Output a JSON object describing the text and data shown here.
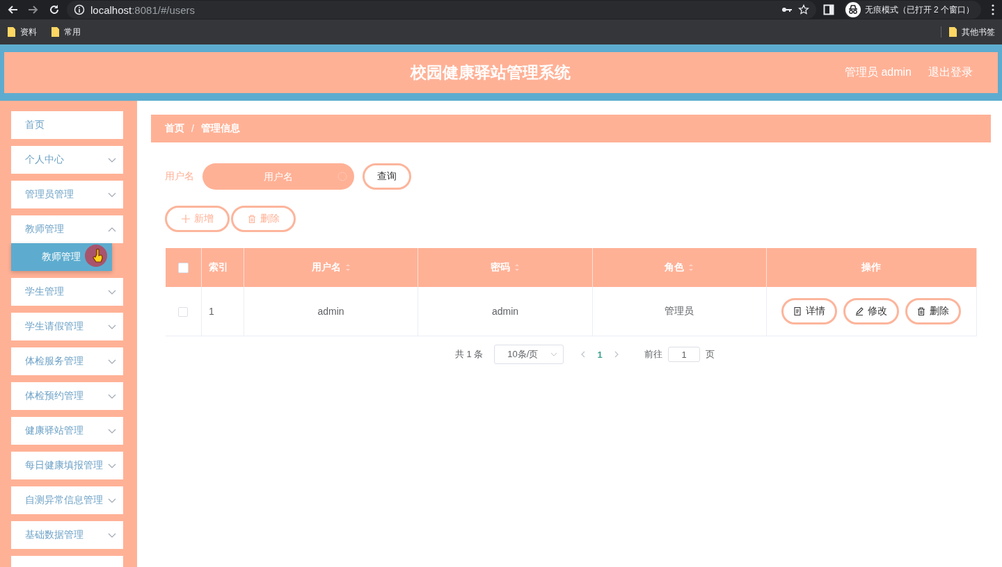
{
  "browser": {
    "url_host": "localhost",
    "url_rest": ":8081/#/users",
    "incognito": "无痕模式（已打开 2 个窗口）",
    "bookmarks": [
      "资料",
      "常用"
    ],
    "other_bookmarks": "其他书签"
  },
  "header": {
    "title": "校园健康驿站管理系统",
    "user": "管理员 admin",
    "logout": "退出登录"
  },
  "sidebar": {
    "items": [
      {
        "label": "首页",
        "expandable": false,
        "expanded": false
      },
      {
        "label": "个人中心",
        "expandable": true,
        "expanded": false
      },
      {
        "label": "管理员管理",
        "expandable": true,
        "expanded": false
      },
      {
        "label": "教师管理",
        "expandable": true,
        "expanded": true,
        "children": [
          {
            "label": "教师管理",
            "selected": true
          }
        ]
      },
      {
        "label": "学生管理",
        "expandable": true,
        "expanded": false
      },
      {
        "label": "学生请假管理",
        "expandable": true,
        "expanded": false
      },
      {
        "label": "体检服务管理",
        "expandable": true,
        "expanded": false
      },
      {
        "label": "体检预约管理",
        "expandable": true,
        "expanded": false
      },
      {
        "label": "健康驿站管理",
        "expandable": true,
        "expanded": false
      },
      {
        "label": "每日健康填报管理",
        "expandable": true,
        "expanded": false
      },
      {
        "label": "自测异常信息管理",
        "expandable": true,
        "expanded": false
      },
      {
        "label": "基础数据管理",
        "expandable": true,
        "expanded": false
      }
    ]
  },
  "breadcrumb": {
    "separator": "/",
    "items": [
      "首页",
      "管理信息"
    ]
  },
  "search": {
    "label": "用户名",
    "placeholder": "用户名",
    "button": "查询"
  },
  "actions": [
    {
      "kind": "add",
      "label": "新增"
    },
    {
      "kind": "delete",
      "label": "删除"
    }
  ],
  "table": {
    "all_checked": false,
    "columns": [
      {
        "label": "索引",
        "sortable": false
      },
      {
        "label": "用户名",
        "sortable": true
      },
      {
        "label": "密码",
        "sortable": true
      },
      {
        "label": "角色",
        "sortable": true
      },
      {
        "label": "操作",
        "sortable": false
      }
    ],
    "rows": [
      {
        "checked": false,
        "cells": [
          "1",
          "admin",
          "admin",
          "管理员"
        ],
        "actions": [
          {
            "kind": "detail",
            "label": "详情"
          },
          {
            "kind": "edit",
            "label": "修改"
          },
          {
            "kind": "delete",
            "label": "删除"
          }
        ]
      }
    ]
  },
  "pagination": {
    "total": "共 1 条",
    "page_size": "10条/页",
    "pages": [
      {
        "label": "1",
        "selected": true
      }
    ],
    "goto": "前往",
    "goto_value": "1",
    "page_unit": "页"
  }
}
